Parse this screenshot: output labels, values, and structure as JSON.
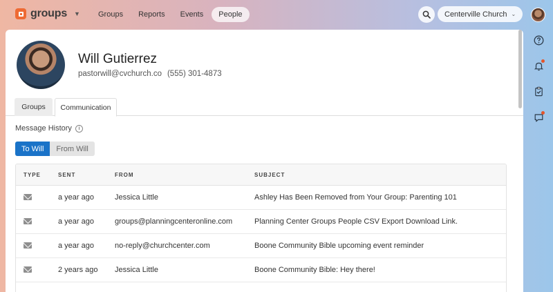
{
  "app": {
    "name": "groups"
  },
  "nav": {
    "links": [
      "Groups",
      "Reports",
      "Events",
      "People"
    ],
    "active": "People",
    "org": "Centerville Church"
  },
  "icons": {
    "search": "search-icon",
    "help": "help-icon",
    "notifications": "bell-icon",
    "tasks": "clipboard-check-icon",
    "messages": "chat-icon",
    "type": "envelope-icon",
    "info": "info-icon"
  },
  "colors": {
    "accent": "#1a73c8",
    "brand": "#ee6a33",
    "badge": "#e4552a"
  },
  "profile": {
    "name": "Will Gutierrez",
    "email": "pastorwill@cvchurch.co",
    "phone": "(555) 301-4873"
  },
  "tabs": [
    "Groups",
    "Communication"
  ],
  "active_tab": "Communication",
  "message_history": {
    "label": "Message History",
    "info_glyph": "i",
    "toggle": {
      "to": "To Will",
      "from": "From Will",
      "active": "To Will"
    },
    "columns": [
      "TYPE",
      "SENT",
      "FROM",
      "SUBJECT"
    ],
    "rows": [
      {
        "sent": "a year ago",
        "from": "Jessica Little",
        "subject": "Ashley Has Been Removed from Your Group: Parenting 101"
      },
      {
        "sent": "a year ago",
        "from": "groups@planningcenteronline.com",
        "subject": "Planning Center Groups People CSV Export Download Link."
      },
      {
        "sent": "a year ago",
        "from": "no-reply@churchcenter.com",
        "subject": "Boone Community Bible upcoming event reminder"
      },
      {
        "sent": "2 years ago",
        "from": "Jessica Little",
        "subject": "Boone Community Bible: Hey there!"
      }
    ]
  }
}
